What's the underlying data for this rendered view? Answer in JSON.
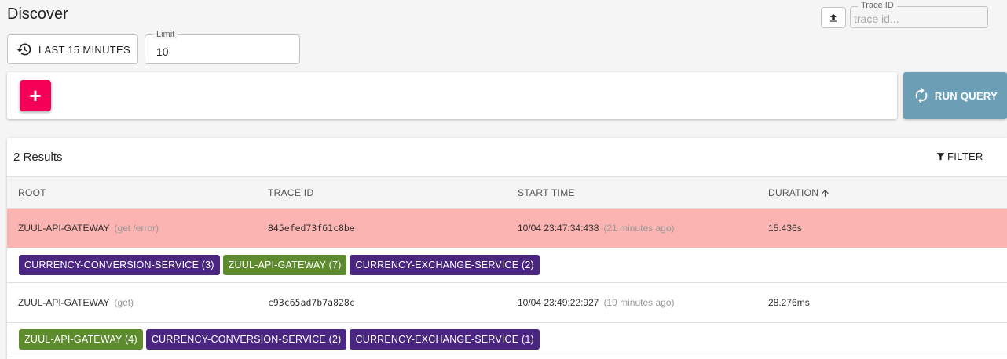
{
  "page": {
    "title": "Discover"
  },
  "topbar": {
    "trace_id_label": "Trace ID",
    "trace_id_placeholder": "trace id...",
    "upload_icon": "upload-icon"
  },
  "query": {
    "time_range_label": "LAST 15 MINUTES",
    "limit_label": "Limit",
    "limit_value": "10",
    "add_label": "+",
    "run_label": "RUN QUERY"
  },
  "results": {
    "count_label": "2 Results",
    "filter_label": "FILTER",
    "columns": [
      "ROOT",
      "TRACE ID",
      "START TIME",
      "DURATION"
    ],
    "sort_column": "DURATION",
    "rows": [
      {
        "service": "ZUUL-API-GATEWAY",
        "endpoint": "(get /error)",
        "trace_id": "845efed73f61c8be",
        "start_time": "10/04 23:47:34:438",
        "relative_time": "(21 minutes ago)",
        "duration": "15.436s",
        "error": true,
        "badges": [
          {
            "label": "CURRENCY-CONVERSION-SERVICE (3)",
            "color": "#4a2681"
          },
          {
            "label": "ZUUL-API-GATEWAY (7)",
            "color": "#5f8b2f"
          },
          {
            "label": "CURRENCY-EXCHANGE-SERVICE (2)",
            "color": "#4a2681"
          }
        ]
      },
      {
        "service": "ZUUL-API-GATEWAY",
        "endpoint": "(get)",
        "trace_id": "c93c65ad7b7a828c",
        "start_time": "10/04 23:49:22:927",
        "relative_time": "(19 minutes ago)",
        "duration": "28.276ms",
        "error": false,
        "badges": [
          {
            "label": "ZUUL-API-GATEWAY (4)",
            "color": "#5f8b2f"
          },
          {
            "label": "CURRENCY-CONVERSION-SERVICE (2)",
            "color": "#4a2681"
          },
          {
            "label": "CURRENCY-EXCHANGE-SERVICE (1)",
            "color": "#4a2681"
          }
        ]
      }
    ]
  },
  "colors": {
    "error_row": "#fbb4b1",
    "add_button": "#f50057",
    "run_button": "#6c9fb6"
  }
}
